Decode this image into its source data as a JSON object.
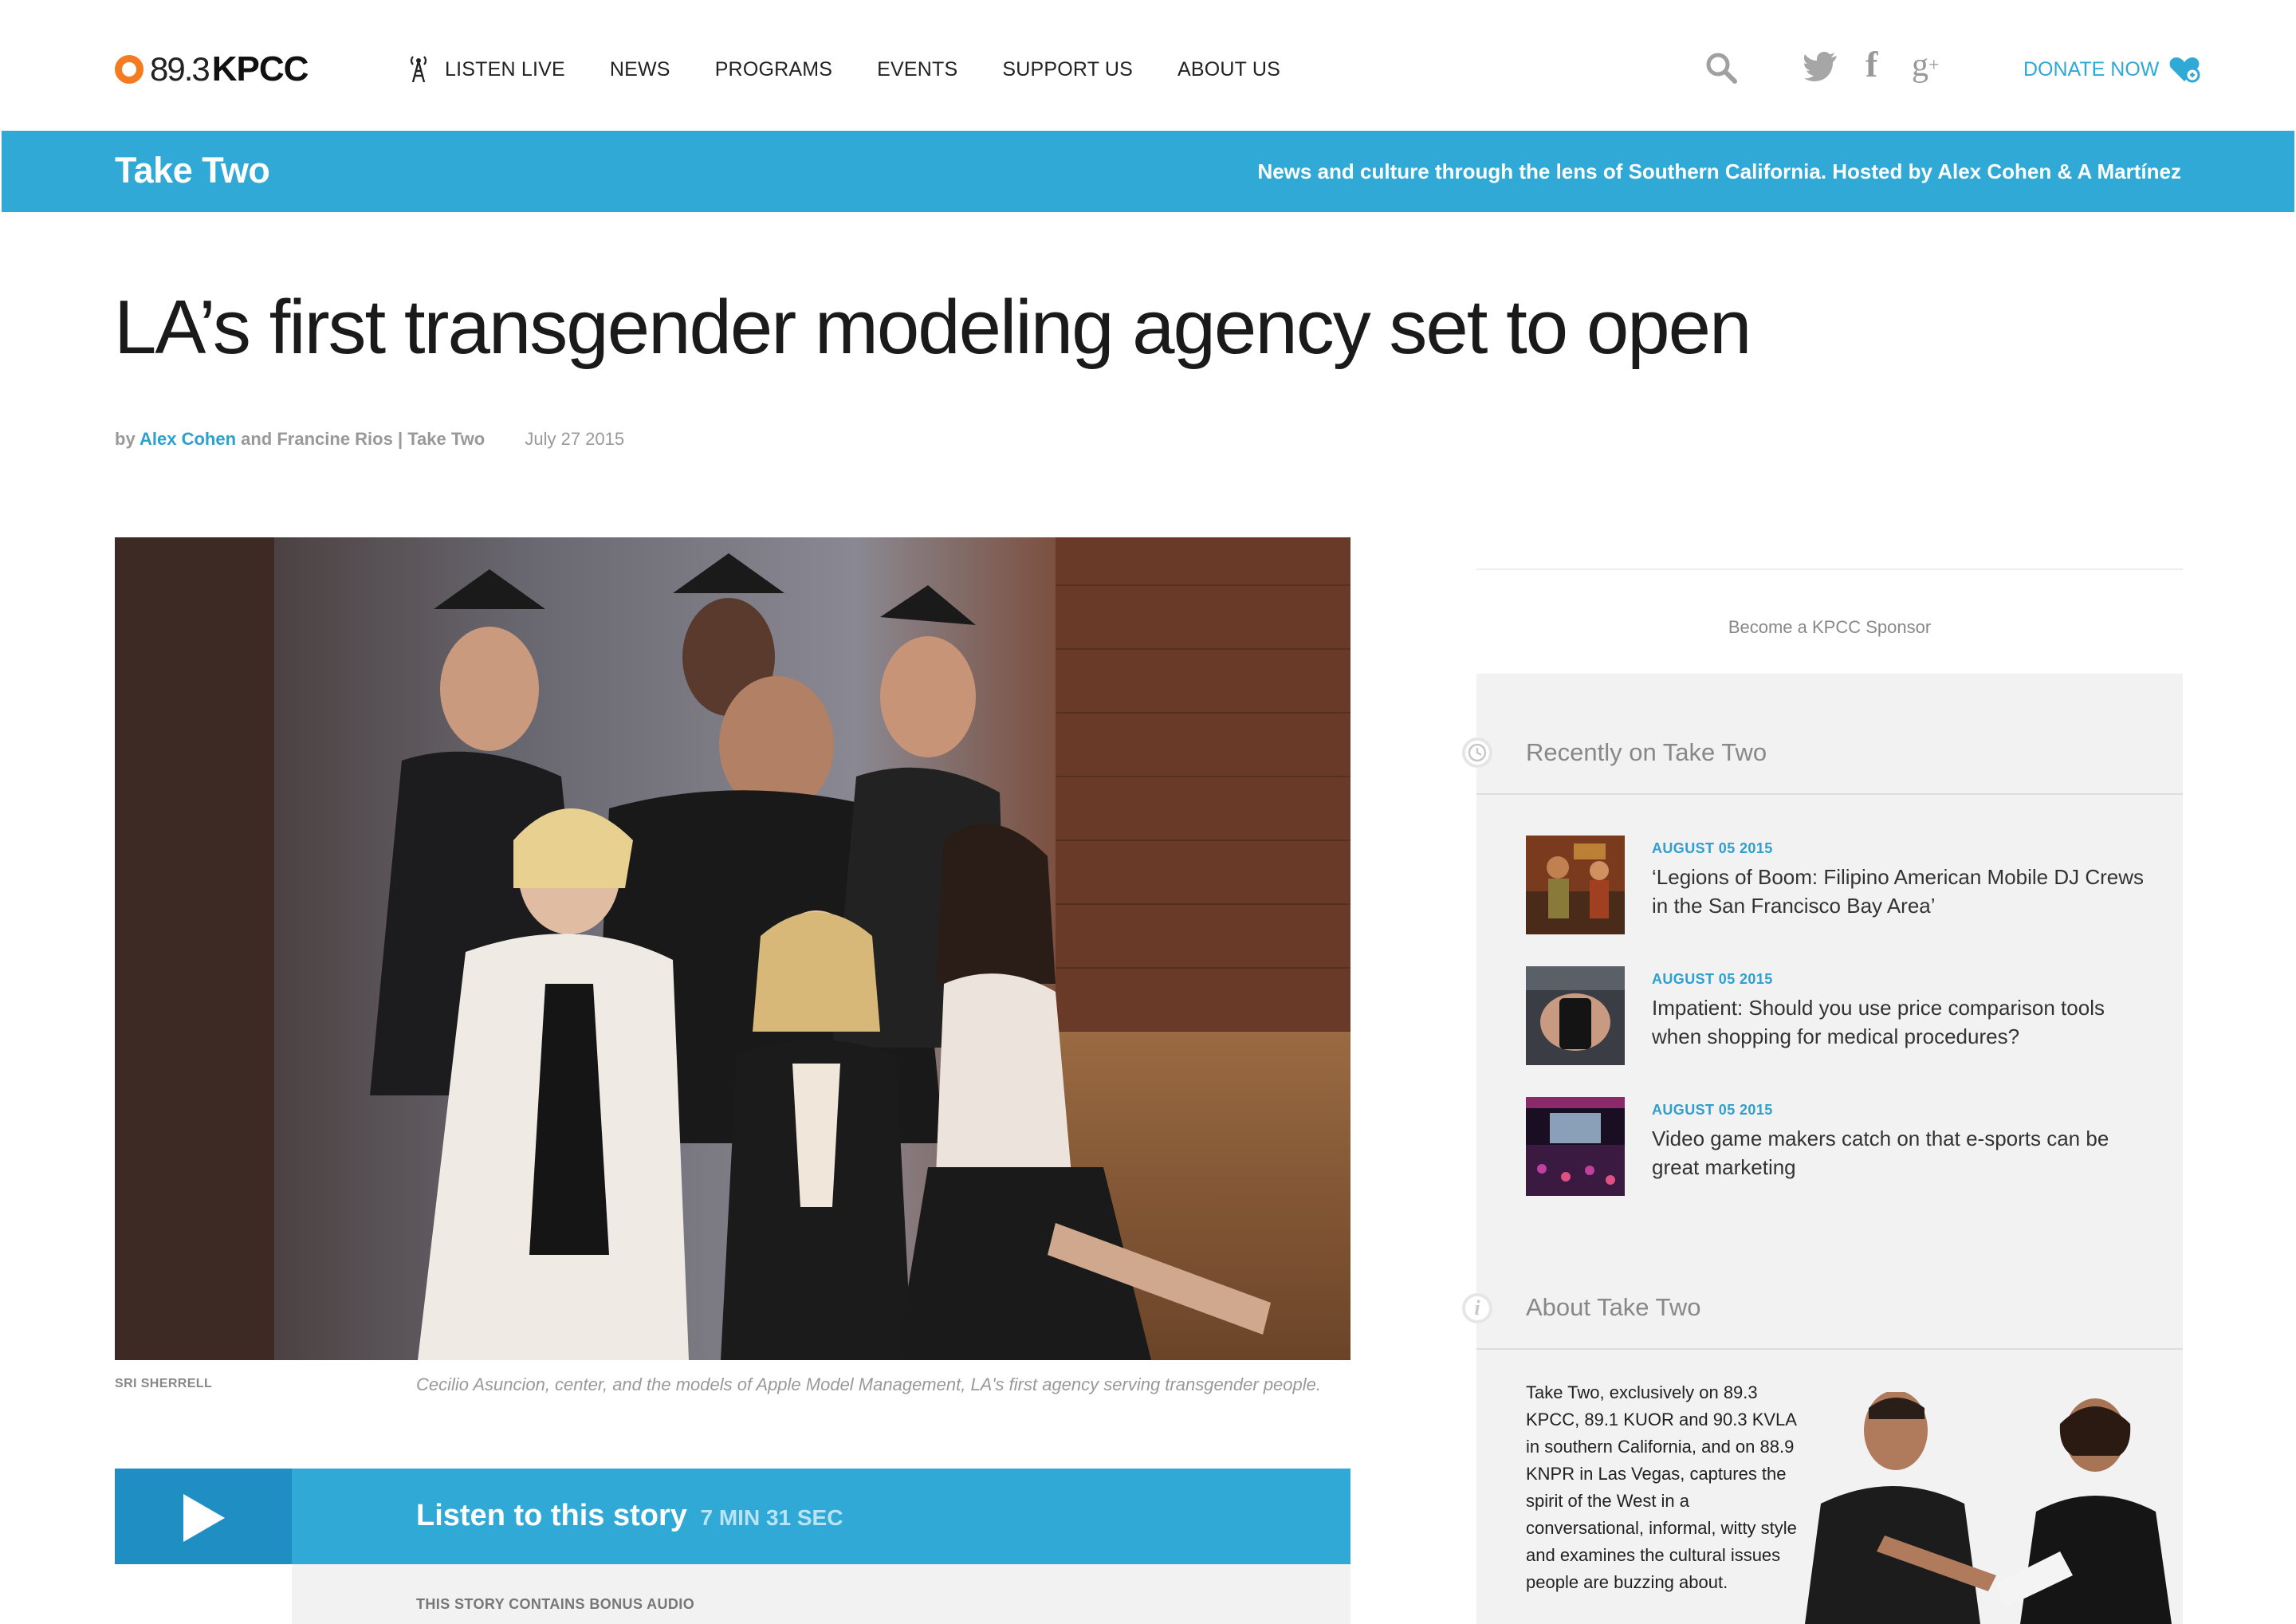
{
  "logo": {
    "frequency": "89.3",
    "call_sign": "KPCC"
  },
  "nav": {
    "listen_live": "LISTEN LIVE",
    "items": [
      "NEWS",
      "PROGRAMS",
      "EVENTS",
      "SUPPORT US",
      "ABOUT US"
    ],
    "donate": "DONATE NOW",
    "icons": [
      "radio-tower-icon",
      "search-icon",
      "twitter-icon",
      "facebook-icon",
      "google-plus-icon",
      "heart-icon"
    ]
  },
  "program": {
    "title": "Take Two",
    "tagline": "News and culture through the lens of Southern California. Hosted by Alex Cohen & A Martínez"
  },
  "article": {
    "headline": "LA’s first transgender modeling agency set to open",
    "by": "by",
    "author1": "Alex Cohen",
    "and_author2": " and Francine Rios",
    "separator": " | ",
    "program": "Take Two",
    "date": "July 27 2015",
    "photo_credit": "SRI SHERRELL",
    "caption": "Cecilio Asuncion, center, and the models of Apple Model Management, LA's first agency serving transgender people."
  },
  "player": {
    "label": "Listen to this story",
    "duration": "7 MIN 31 SEC",
    "bonus": "THIS STORY CONTAINS BONUS AUDIO"
  },
  "sidebar": {
    "sponsor": "Become a KPCC Sponsor",
    "recent_heading": "Recently on Take Two",
    "recent": [
      {
        "date": "AUGUST 05 2015",
        "title": "‘Legions of Boom: Filipino American Mobile DJ Crews in the San Francisco Bay Area’"
      },
      {
        "date": "AUGUST 05 2015",
        "title": "Impatient: Should you use price comparison tools when shopping for medical procedures?"
      },
      {
        "date": "AUGUST 05 2015",
        "title": "Video game makers catch on that e-sports can be great marketing"
      }
    ],
    "about_heading": "About Take Two",
    "about_text": "Take Two, exclusively on 89.3 KPCC, 89.1 KUOR and 90.3 KVLA in southern California, and on 88.9 KNPR in Las Vegas, captures the spirit of the West in a conversational, informal, witty style and examines the cultural issues people are buzzing about."
  },
  "colors": {
    "accent": "#30a9d6",
    "accent_dark": "#1f8fc3",
    "logo_orange": "#f47b20",
    "sidebar_bg": "#f2f2f2"
  }
}
